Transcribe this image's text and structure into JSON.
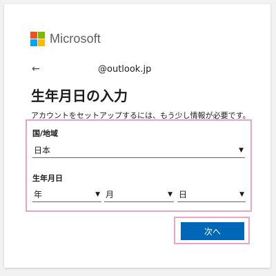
{
  "brand": {
    "name": "Microsoft",
    "colors": [
      "#f25022",
      "#7fba00",
      "#00a4ef",
      "#ffb900"
    ]
  },
  "identity": {
    "back_icon": "←",
    "email": "@outlook.jp"
  },
  "page": {
    "title": "生年月日の入力",
    "description": "アカウントをセットアップするには、もう少し情報が必要です。"
  },
  "country": {
    "label": "国/地域",
    "value": "日本"
  },
  "birthdate": {
    "label": "生年月日",
    "year": "年",
    "month": "月",
    "day": "日"
  },
  "dropdown_arrow": "▼",
  "actions": {
    "next_label": "次へ"
  },
  "accent_colors": {
    "button": "#0067b8",
    "highlight": "#e8a3c5"
  }
}
